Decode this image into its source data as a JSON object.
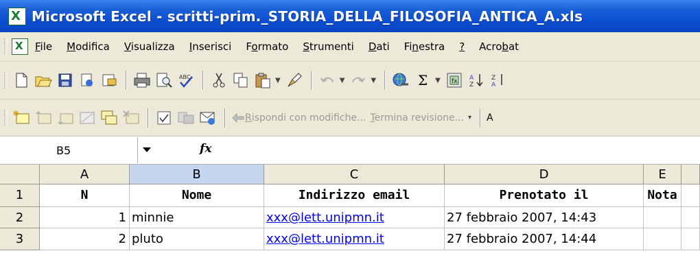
{
  "window": {
    "title": "Microsoft Excel - scritti-prim._STORIA_DELLA_FILOSOFIA_ANTICA_A.xls"
  },
  "menu": [
    {
      "pre": "",
      "u": "F",
      "post": "ile"
    },
    {
      "pre": "",
      "u": "M",
      "post": "odifica"
    },
    {
      "pre": "",
      "u": "V",
      "post": "isualizza"
    },
    {
      "pre": "",
      "u": "I",
      "post": "nserisci"
    },
    {
      "pre": "F",
      "u": "o",
      "post": "rmato"
    },
    {
      "pre": "",
      "u": "S",
      "post": "trumenti"
    },
    {
      "pre": "",
      "u": "D",
      "post": "ati"
    },
    {
      "pre": "Fi",
      "u": "n",
      "post": "estra"
    },
    {
      "pre": "",
      "u": "?",
      "post": ""
    },
    {
      "pre": "Acro",
      "u": "b",
      "post": "at"
    }
  ],
  "toolbar2": {
    "reply_pre": "",
    "reply_u": "R",
    "reply_post": "ispondi con modifiche...",
    "end_pre": "",
    "end_u": "T",
    "end_post": "ermina revisione...",
    "trailing": "A"
  },
  "formula_bar": {
    "name_box": "B5",
    "fx": "fx",
    "formula": ""
  },
  "sheet": {
    "selected_column": "B",
    "columns": [
      "A",
      "B",
      "C",
      "D",
      "E"
    ],
    "rows": [
      {
        "num": "1",
        "a": "N",
        "b": "Nome",
        "c": "Indirizzo email",
        "d": "Prenotato il",
        "e": "Nota"
      },
      {
        "num": "2",
        "a": "1",
        "b": "minnie",
        "c": "xxx@lett.unipmn.it",
        "d": "27 febbraio 2007, 14:43",
        "e": ""
      },
      {
        "num": "3",
        "a": "2",
        "b": "pluto",
        "c": "xxx@lett.unipmn.it",
        "d": "27 febbraio 2007, 14:44",
        "e": ""
      }
    ]
  },
  "colors": {
    "title_bar": "#0a4cd0",
    "toolbar_bg": "#ece9d8",
    "selected_header": "#c6d6f0",
    "link": "#0000ff"
  }
}
